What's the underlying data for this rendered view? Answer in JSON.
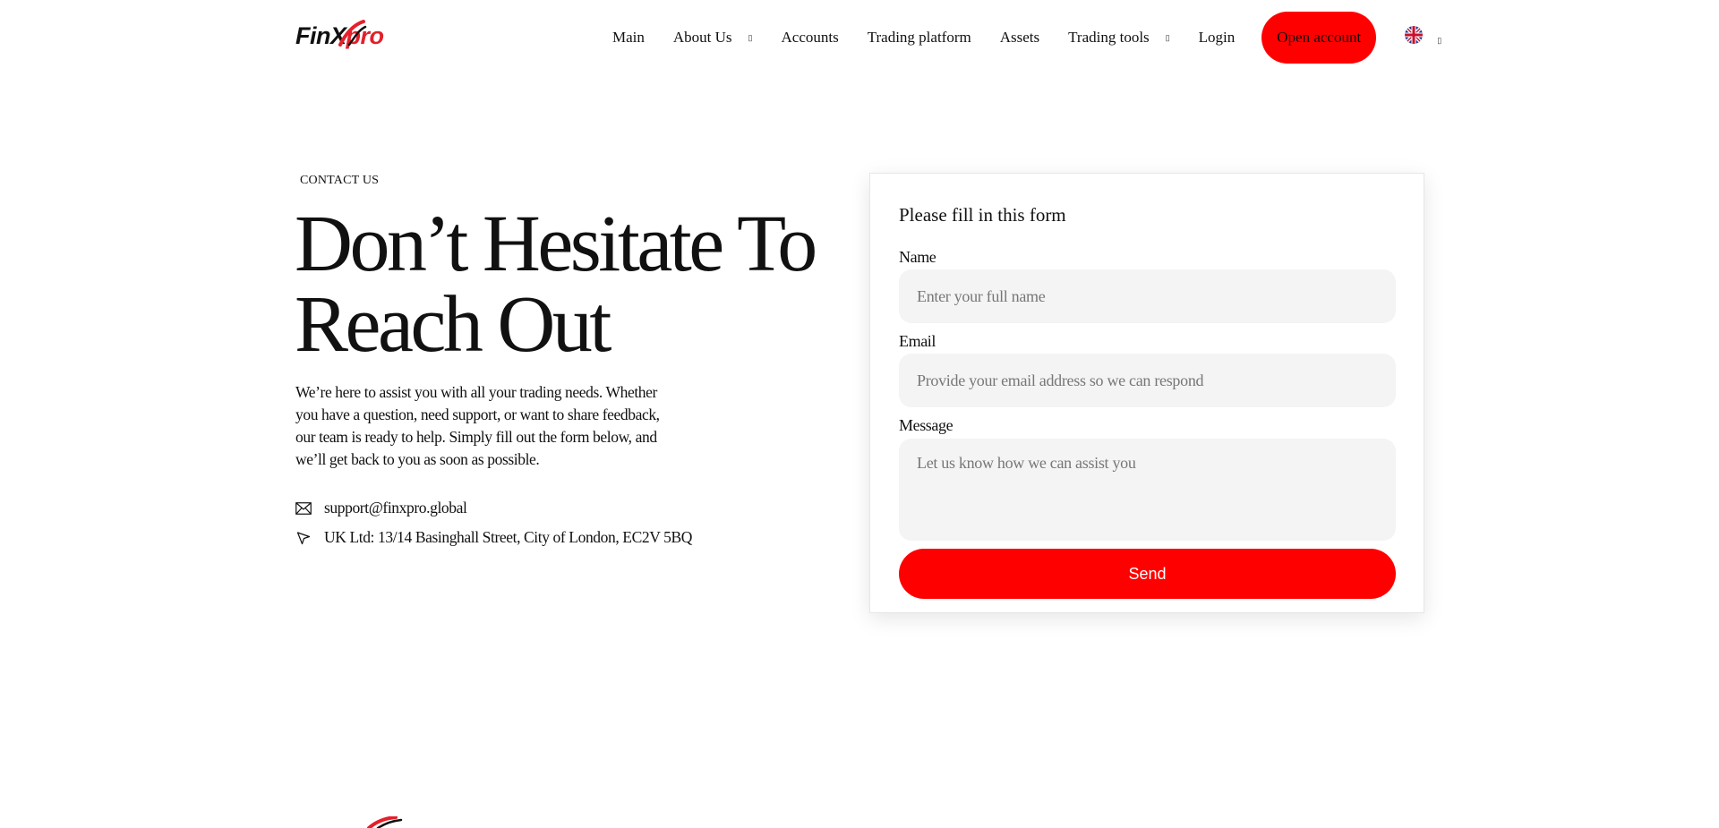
{
  "header": {
    "logo": {
      "text_main": "FinX",
      "text_accent": "pro"
    },
    "nav": [
      {
        "label": "Main",
        "has_dropdown": false
      },
      {
        "label": "About Us",
        "has_dropdown": true
      },
      {
        "label": "Accounts",
        "has_dropdown": false
      },
      {
        "label": "Trading platform",
        "has_dropdown": false
      },
      {
        "label": "Assets",
        "has_dropdown": false
      },
      {
        "label": "Trading tools",
        "has_dropdown": true
      },
      {
        "label": "Login",
        "has_dropdown": false
      }
    ],
    "cta_label": "Open account",
    "language_icon": "uk-flag-icon"
  },
  "hero": {
    "eyebrow": "CONTACT US",
    "title_line1": "Don’t Hesitate To",
    "title_line2": "Reach Out",
    "description": "We’re here to assist you with all your trading needs. Whether you have a question, need support, or want to share feedback, our team is ready to help. Simply fill out the form below, and we’ll get back to you as soon as possible."
  },
  "contact": {
    "email": "support@finxpro.global",
    "email_icon": "envelope-icon",
    "address": "UK Ltd: 13/14 Basinghall Street, City of London, EC2V 5BQ",
    "address_icon": "location-arrow-icon"
  },
  "form": {
    "title": "Please fill in this form",
    "name_label": "Name",
    "name_placeholder": "Enter your full name",
    "email_label": "Email",
    "email_placeholder": "Provide your email address so we can respond",
    "message_label": "Message",
    "message_placeholder": "Let us know how we can assist you",
    "submit_label": "Send"
  },
  "colors": {
    "accent": "#ff0000",
    "text": "#111111",
    "field_bg": "#f4f4f4"
  }
}
